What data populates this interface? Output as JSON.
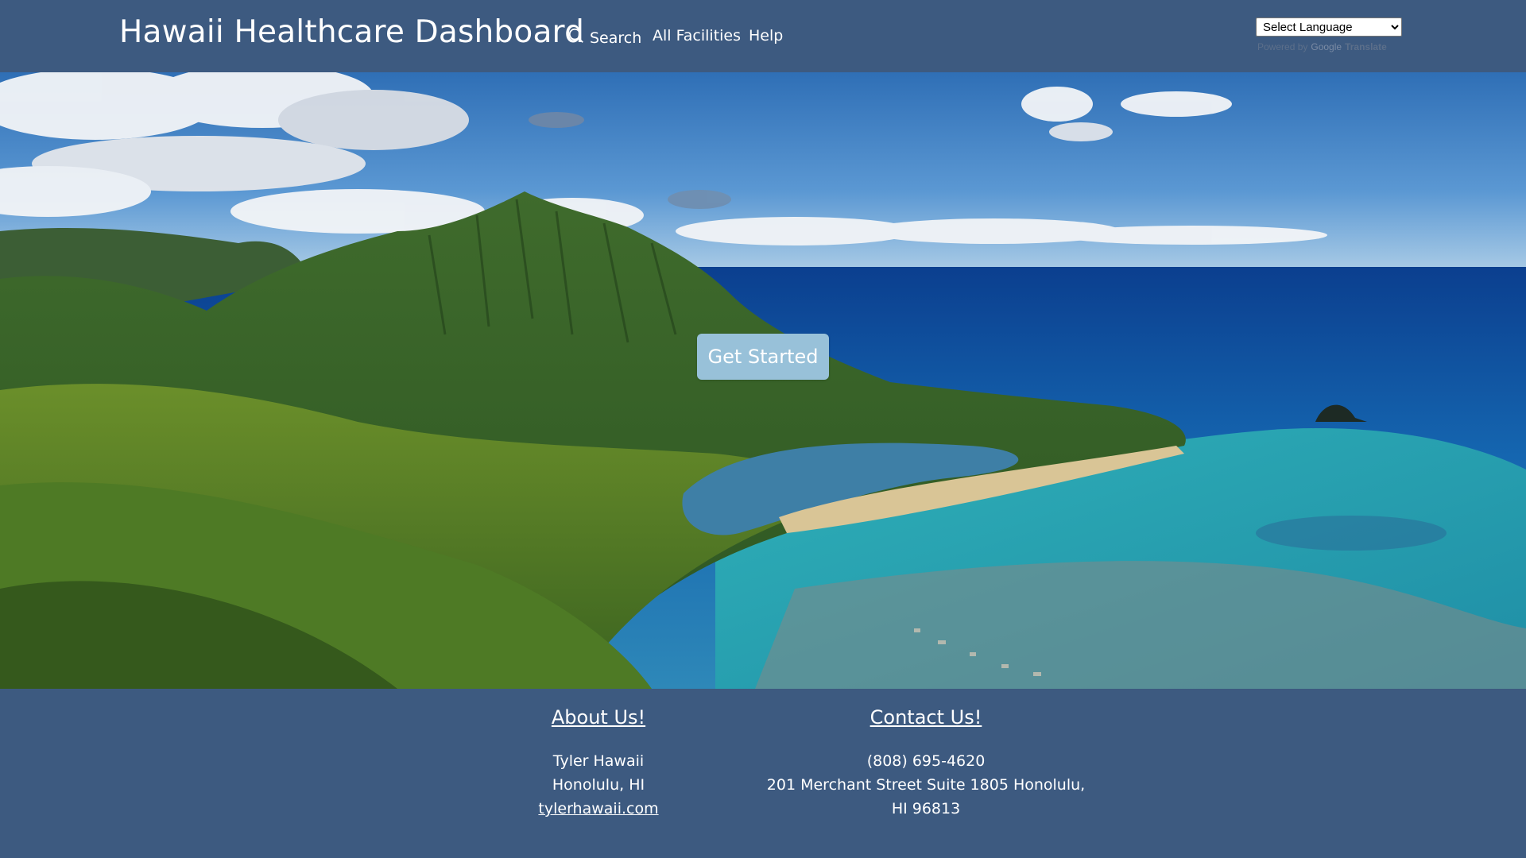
{
  "header": {
    "title": "Hawaii Healthcare Dashboard",
    "nav": {
      "search": "Search",
      "all_facilities": "All Facilities",
      "help": "Help"
    },
    "language_select": {
      "selected": "Select Language",
      "powered_by": "Powered by",
      "google": "Google",
      "translate": "Translate"
    }
  },
  "hero": {
    "cta_label": "Get Started"
  },
  "footer": {
    "about": {
      "heading": "About Us!",
      "name": "Tyler Hawaii",
      "location": "Honolulu, HI",
      "link": "tylerhawaii.com"
    },
    "contact": {
      "heading": "Contact Us!",
      "phone": "(808) 695-4620",
      "address_line1": "201 Merchant Street Suite 1805 Honolulu,",
      "address_line2": "HI 96813"
    }
  },
  "colors": {
    "navy": "#3d5a80",
    "button_light_blue": "#98c1d9",
    "text": "#ffffff"
  },
  "icons": {
    "search": "search-icon"
  }
}
